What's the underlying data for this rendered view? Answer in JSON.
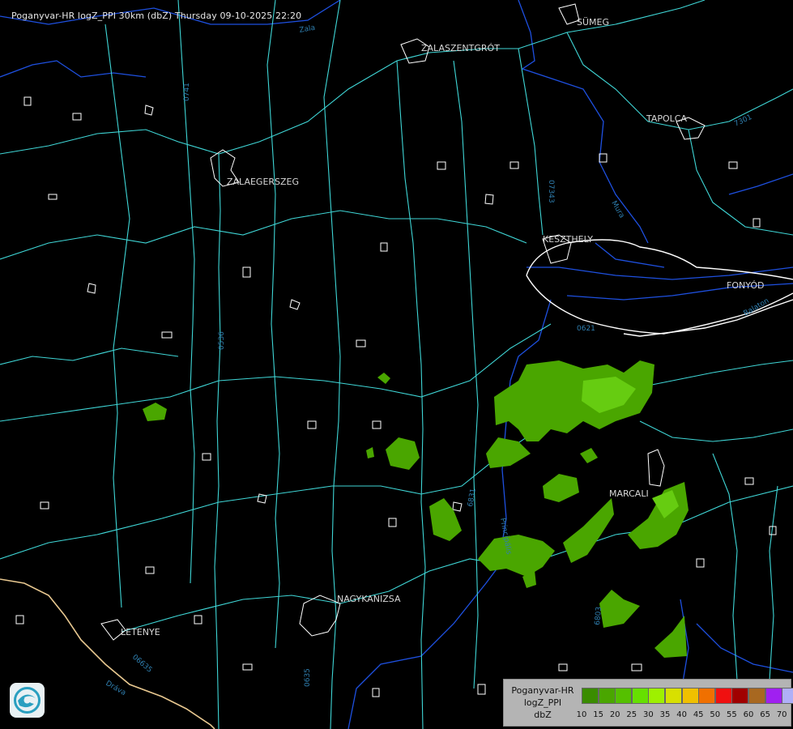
{
  "title": "Poganyvar-HR logZ_PPI 30km (dbZ) Thursday 09-10-2025 22:20",
  "cities": [
    {
      "name": "SÜMEG",
      "id": "sumeg"
    },
    {
      "name": "ZALASZENTGRÓT",
      "id": "zalaszentgrot"
    },
    {
      "name": "TAPOLCA",
      "id": "tapolca"
    },
    {
      "name": "ZALAEGERSZEG",
      "id": "zalaegerszeg"
    },
    {
      "name": "KESZTHELY",
      "id": "keszthely"
    },
    {
      "name": "FONYÓD",
      "id": "fonyod"
    },
    {
      "name": "MARCALI",
      "id": "marcali"
    },
    {
      "name": "NAGYKANIZSA",
      "id": "nagykanizsa"
    },
    {
      "name": "LETENYE",
      "id": "letenye"
    }
  ],
  "road_labels": [
    "0741",
    "07343",
    "7301",
    "0536",
    "6831",
    "0635",
    "06635",
    "0621",
    "6803",
    "Zala",
    "Balaton",
    "Principális",
    "Dráva",
    "Mura"
  ],
  "legend": {
    "name_line1": "Poganyvar-HR",
    "name_line2": "logZ_PPI",
    "name_line3": "dbZ",
    "levels": [
      {
        "label": "10",
        "color": "#3a8c00"
      },
      {
        "label": "15",
        "color": "#4aa600"
      },
      {
        "label": "20",
        "color": "#55c000"
      },
      {
        "label": "25",
        "color": "#66e000"
      },
      {
        "label": "30",
        "color": "#9ef000"
      },
      {
        "label": "35",
        "color": "#d8e000"
      },
      {
        "label": "40",
        "color": "#f0c000"
      },
      {
        "label": "45",
        "color": "#f07000"
      },
      {
        "label": "50",
        "color": "#f01010"
      },
      {
        "label": "55",
        "color": "#a00000"
      },
      {
        "label": "60",
        "color": "#a86820"
      },
      {
        "label": "65",
        "color": "#a020f0"
      },
      {
        "label": "70",
        "color": "#b0b0f8"
      }
    ]
  },
  "colors": {
    "background": "#000000",
    "rivers": "#1e50e0",
    "roads": "#3fd6d6",
    "settlements": "#ffffff",
    "border": "#e8c890",
    "echo_weak": "#4aa600",
    "echo_moderate": "#66cc11"
  },
  "logo": "radar-logo-icon"
}
